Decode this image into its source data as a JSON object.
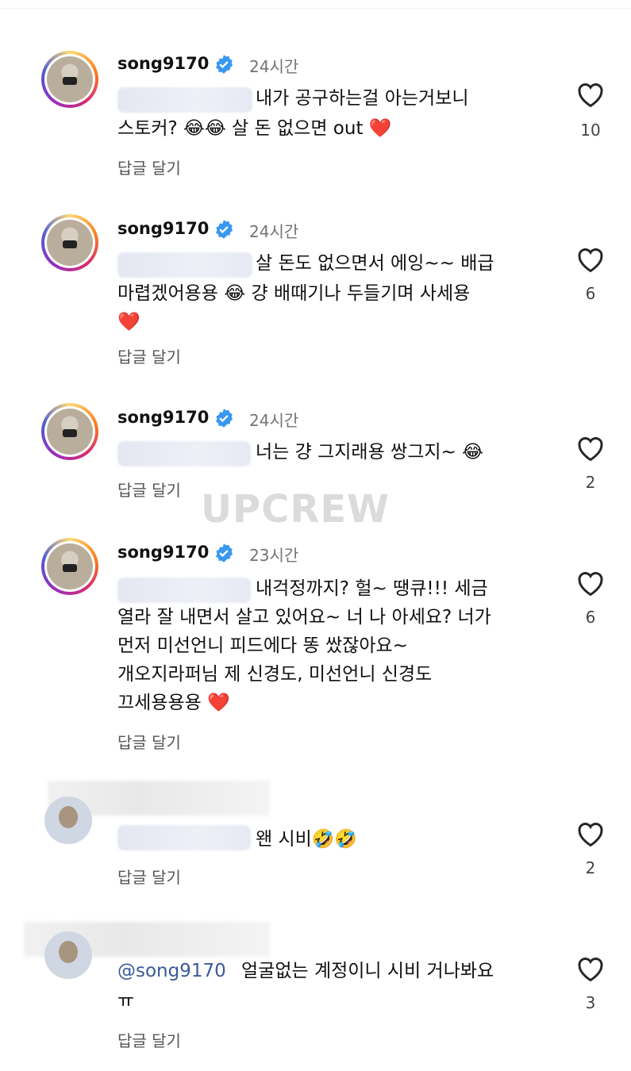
{
  "watermark": "UPCREW",
  "comments": [
    {
      "username": "song9170",
      "time": "24시간",
      "lines": [
        "내가 공구하는걸 아는거보니",
        "스토커? 😂😂 살 돈 없으면 out ❤️"
      ],
      "reply": "답글 달기",
      "likes": "10",
      "avatar": "profile-photo"
    },
    {
      "username": "song9170",
      "time": "24시간",
      "lines": [
        "살 돈도 없으면서 에잉~~ 배급",
        "마렵겠어용용 😂 걍 배때기나 두들기며 사세용",
        "❤️"
      ],
      "reply": "답글 달기",
      "likes": "6",
      "avatar": "profile-photo"
    },
    {
      "username": "song9170",
      "time": "24시간",
      "lines": [
        "너는 걍 그지래용 쌍그지~ 😂"
      ],
      "reply": "답글 달기",
      "likes": "2",
      "avatar": "profile-photo"
    },
    {
      "username": "song9170",
      "time": "23시간",
      "lines": [
        "내걱정까지? 헐~ 땡큐!!! 세금",
        "열라 잘 내면서 살고 있어요~ 너 나 아세요? 너가",
        "먼저 미선언니 피드에다 똥 쌌잖아요~",
        "개오지라퍼님 제 신경도, 미선언니 신경도",
        "끄세용용용 ❤️"
      ],
      "reply": "답글 달기",
      "likes": "6",
      "avatar": "profile-photo"
    },
    {
      "lines": [
        "왠 시비🤣🤣"
      ],
      "reply": "답글 달기",
      "likes": "2",
      "avatar": "blurred-user"
    },
    {
      "mention": "@song9170",
      "lines": [
        "얼굴없는 계정이니 시비 거나봐요",
        "ㅠ"
      ],
      "reply": "답글 달기",
      "likes": "3",
      "avatar": "blurred-user"
    }
  ],
  "colors": {
    "verified": "#3897f0",
    "muted": "#737373",
    "heart_outline": "#262626"
  }
}
